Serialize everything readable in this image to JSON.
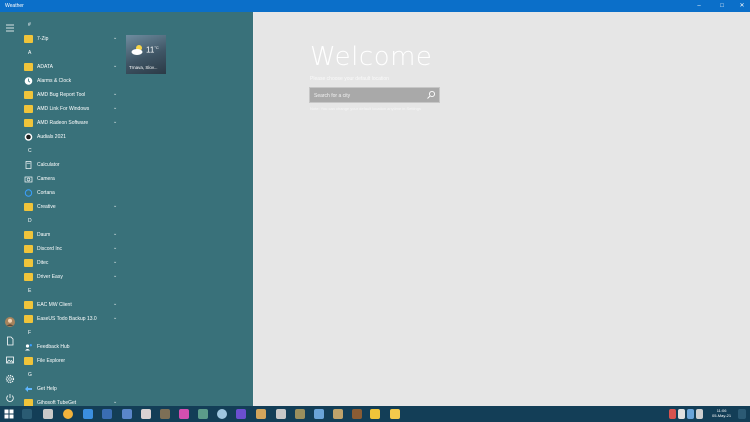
{
  "window": {
    "title": "Weather",
    "controls": [
      "minimize-icon",
      "maximize-icon",
      "close-icon"
    ]
  },
  "weather_app": {
    "welcome": "Welcome",
    "subtitle": "Please choose your default location",
    "search_placeholder": "Search for a city",
    "hint": "Note: You can change your default location anytime in Settings"
  },
  "start_menu": {
    "rail_icons": [
      "hamburger-menu-icon",
      "user-avatar-icon",
      "documents-icon",
      "pictures-icon",
      "settings-icon",
      "power-icon"
    ],
    "groups": [
      {
        "letter": "#",
        "items": [
          {
            "label": "7-Zip",
            "icon": "folder-icon",
            "expandable": true
          }
        ]
      },
      {
        "letter": "A",
        "items": [
          {
            "label": "ADATA",
            "icon": "folder-icon",
            "expandable": true
          },
          {
            "label": "Alarms & Clock",
            "icon": "alarm-clock-icon",
            "expandable": false
          },
          {
            "label": "AMD Bug Report Tool",
            "icon": "folder-icon",
            "expandable": true
          },
          {
            "label": "AMD Link For Windows",
            "icon": "folder-icon",
            "expandable": true
          },
          {
            "label": "AMD Radeon Software",
            "icon": "folder-icon",
            "expandable": true
          },
          {
            "label": "Audials 2021",
            "icon": "audials-icon",
            "expandable": false
          }
        ]
      },
      {
        "letter": "C",
        "items": [
          {
            "label": "Calculator",
            "icon": "calculator-icon",
            "expandable": false
          },
          {
            "label": "Camera",
            "icon": "camera-icon",
            "expandable": false
          },
          {
            "label": "Cortana",
            "icon": "cortana-icon",
            "expandable": false
          },
          {
            "label": "Creative",
            "icon": "folder-icon",
            "expandable": true
          }
        ]
      },
      {
        "letter": "D",
        "items": [
          {
            "label": "Daum",
            "icon": "folder-icon",
            "expandable": true
          },
          {
            "label": "Discord Inc",
            "icon": "folder-icon",
            "expandable": true
          },
          {
            "label": "Ditec",
            "icon": "folder-icon",
            "expandable": true
          },
          {
            "label": "Driver Easy",
            "icon": "folder-icon",
            "expandable": true
          }
        ]
      },
      {
        "letter": "E",
        "items": [
          {
            "label": "EAC MW Client",
            "icon": "folder-icon",
            "expandable": true
          },
          {
            "label": "EaseUS Todo Backup 13.0",
            "icon": "folder-icon",
            "expandable": true
          }
        ]
      },
      {
        "letter": "F",
        "items": [
          {
            "label": "Feedback Hub",
            "icon": "feedback-hub-icon",
            "expandable": false
          },
          {
            "label": "File Explorer",
            "icon": "file-explorer-icon",
            "expandable": false
          }
        ]
      },
      {
        "letter": "G",
        "items": [
          {
            "label": "Get Help",
            "icon": "get-help-icon",
            "expandable": false
          },
          {
            "label": "Gihosoft TubeGet",
            "icon": "folder-icon",
            "expandable": true
          }
        ]
      }
    ],
    "tile": {
      "temperature": "11",
      "unit": "°C",
      "city": "Trnava, Slov..."
    }
  },
  "taskbar": {
    "clock_time": "11:06",
    "clock_date": "05-May-21",
    "colors": {
      "start_menu": "#39717a",
      "taskbar": "#133e57",
      "titlebar": "#0b6fc9"
    }
  }
}
